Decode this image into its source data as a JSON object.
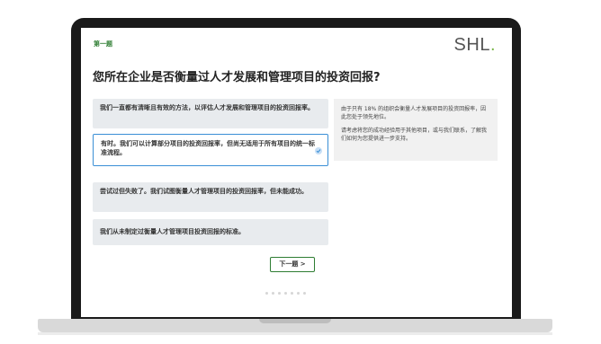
{
  "survey": {
    "question_number": "第一题",
    "logo_text": "SHL",
    "logo_dot": ".",
    "question": "您所在企业是否衡量过人才发展和管理项目的投资回报?",
    "options": [
      {
        "text": "我们一直都有清晰且有效的方法，以评估人才发展和管理项目的投资回报率。"
      },
      {
        "text": "有时。我们可以计算部分项目的投资回报率，但尚无适用于所有项目的统一标准流程。"
      },
      {
        "text": "尝试过但失败了。我们试图衡量人才管理项目的投资回报率，但未能成功。"
      },
      {
        "text": "我们从未制定过衡量人才管理项目投资回报的标准。"
      }
    ],
    "side_panel": {
      "paragraph1": "由于只有 18% 的组织会衡量人才发展项目的投资回报率，因此您处于领先地位。",
      "paragraph2": "请考虑将您的成功经验用于其他项目，或与我们联系，了解我们如何为您提供进一步支持。"
    },
    "next_label": "下一题 >",
    "selected_index": 1
  },
  "colors": {
    "accent_green": "#2e7d32",
    "logo_dot": "#7ab648",
    "selected_border": "#3a8fd6",
    "option_bg": "#e8ebee"
  }
}
